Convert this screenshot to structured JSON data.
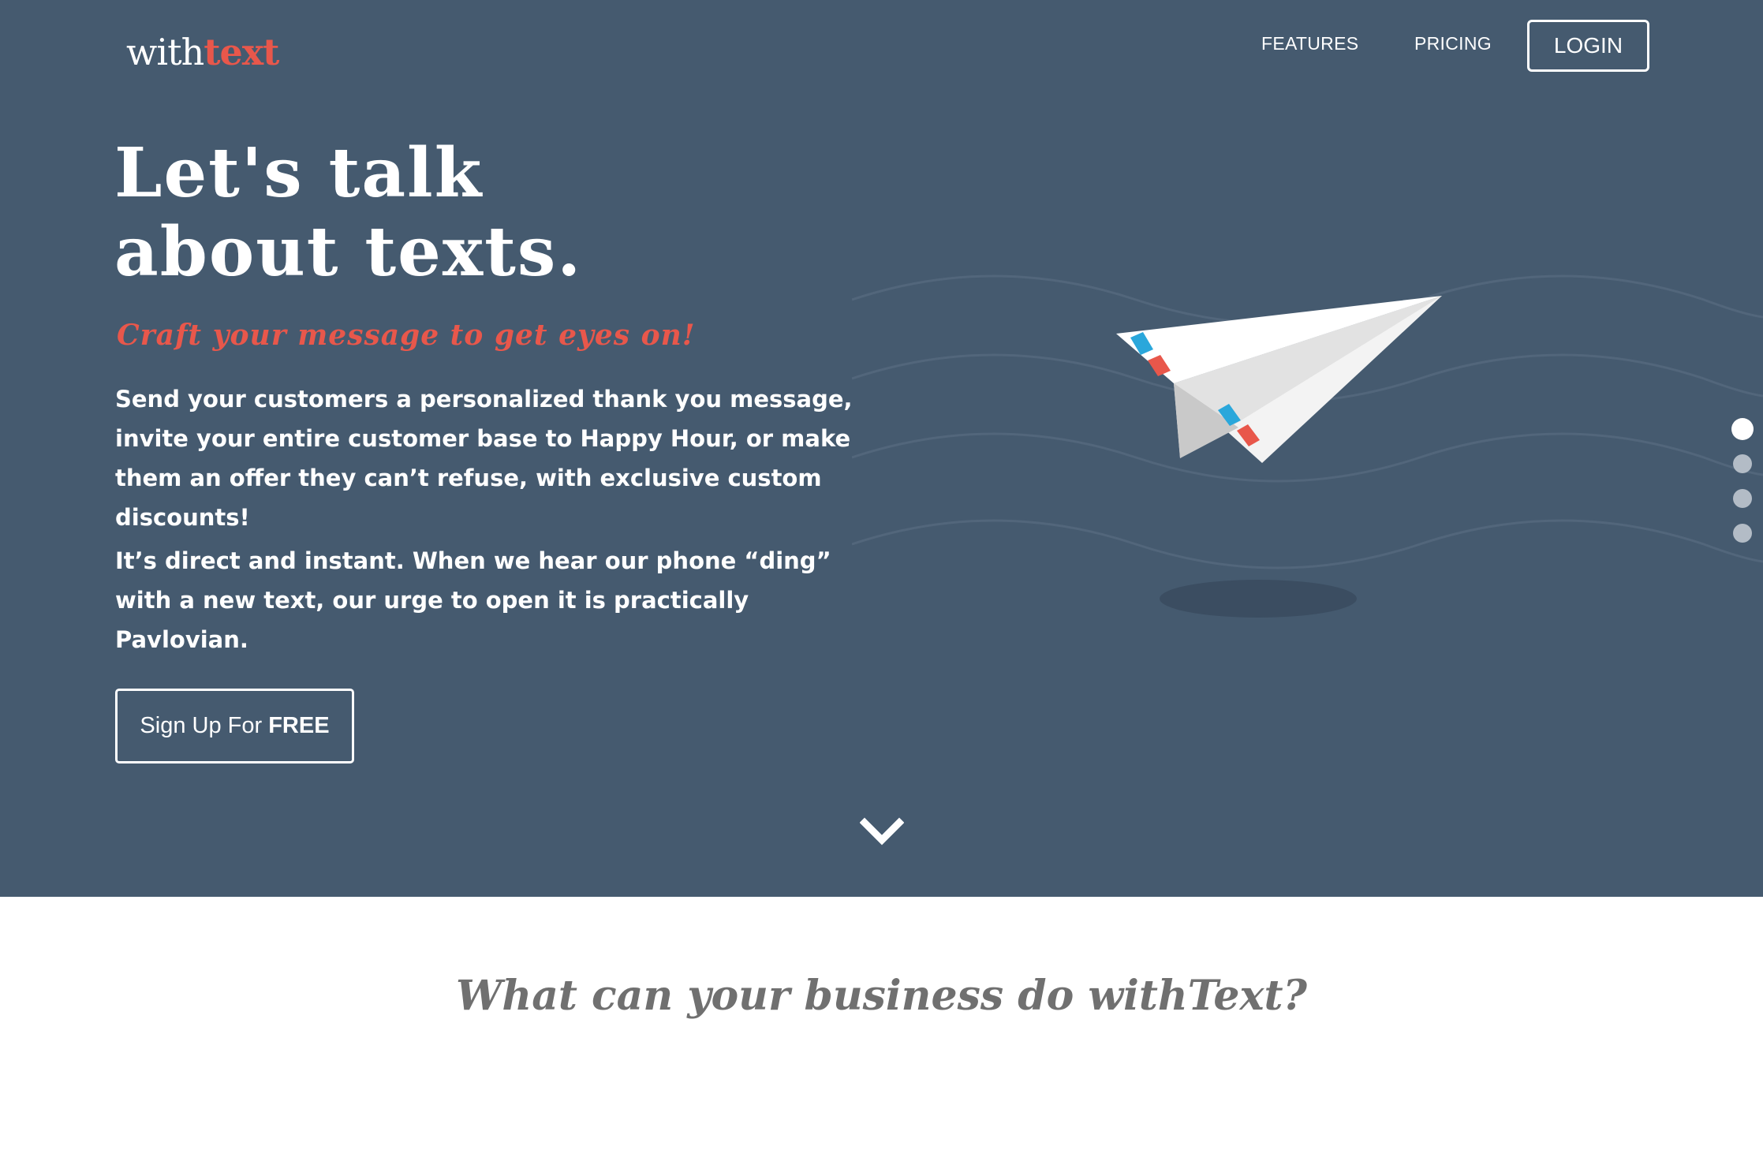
{
  "brand": {
    "logo_part1": "with",
    "logo_part2": "text",
    "accent_color": "#e8574b",
    "hero_background": "#455a6f"
  },
  "nav": {
    "items": [
      {
        "label": "FEATURES"
      },
      {
        "label": "PRICING"
      }
    ],
    "login_label": "LOGIN"
  },
  "hero": {
    "headline_line1": "Let's talk",
    "headline_line2": "about texts.",
    "tagline": "Craft your message to get eyes on!",
    "paragraph1": "Send your customers a personalized thank you message, invite your entire customer base to Happy Hour, or make them an offer they can’t refuse, with exclusive custom discounts!",
    "paragraph2": "It’s direct and instant. When we hear our phone “ding” with a new text, our urge to open it is practically Pavlovian.",
    "cta_label_plain": "Sign Up For",
    "cta_label_strong": "FREE",
    "illustration_icon": "paper-plane-icon",
    "scroll_icon": "chevron-down-icon"
  },
  "pager": {
    "count": 4,
    "active_index": 0
  },
  "features_section": {
    "title": "What can your business do withText?"
  }
}
